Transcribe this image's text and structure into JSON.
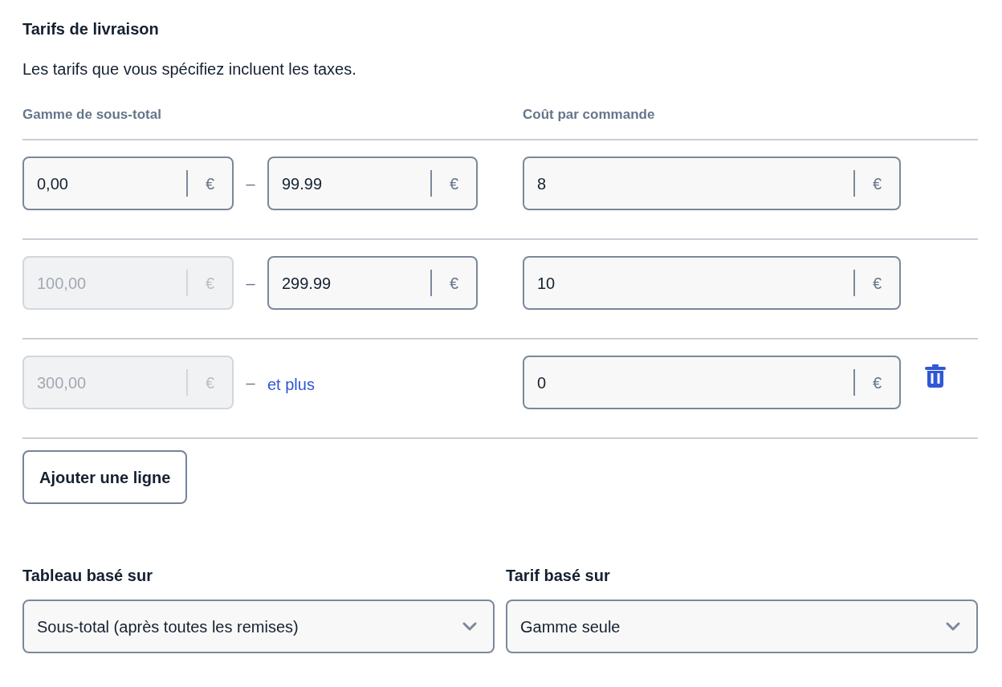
{
  "section": {
    "title": "Tarifs de livraison",
    "description": "Les tarifs que vous spécifiez incluent les taxes."
  },
  "table": {
    "columns": [
      "Gamme de sous-total",
      "Coût par commande"
    ],
    "rows": [
      {
        "from": {
          "value": "0,00",
          "currency": "€",
          "disabled": false
        },
        "separator": "–",
        "to": {
          "kind": "input",
          "value": "99.99",
          "currency": "€"
        },
        "cost": {
          "value": "8",
          "currency": "€"
        },
        "deletable": false
      },
      {
        "from": {
          "value": "100,00",
          "currency": "€",
          "disabled": true
        },
        "separator": "–",
        "to": {
          "kind": "input",
          "value": "299.99",
          "currency": "€"
        },
        "cost": {
          "value": "10",
          "currency": "€"
        },
        "deletable": false
      },
      {
        "from": {
          "value": "300,00",
          "currency": "€",
          "disabled": true
        },
        "separator": "–",
        "to": {
          "kind": "text",
          "text": "et plus"
        },
        "cost": {
          "value": "0",
          "currency": "€"
        },
        "deletable": true
      }
    ]
  },
  "add_button": "Ajouter une ligne",
  "selects": [
    {
      "label": "Tableau basé sur",
      "value": "Sous-total (après toutes les remises)"
    },
    {
      "label": "Tarif basé sur",
      "value": "Gamme seule"
    }
  ]
}
